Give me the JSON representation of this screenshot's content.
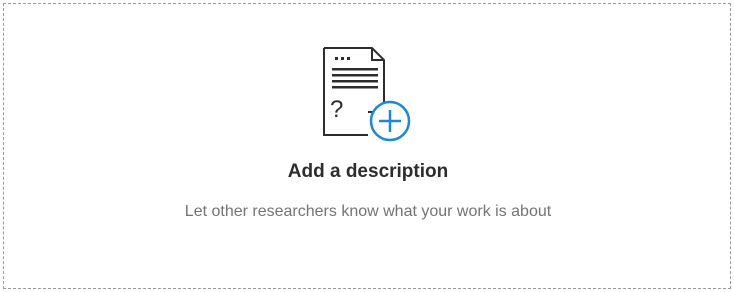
{
  "empty_state": {
    "title": "Add a description",
    "subtitle": "Let other researchers know what your work is about",
    "icon": "document-add-icon",
    "accent_color": "#1a8ad6",
    "text_color": "#2d2d2d",
    "muted_color": "#747474"
  }
}
